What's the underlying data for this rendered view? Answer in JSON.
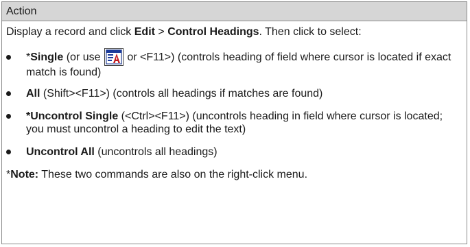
{
  "header": {
    "title": "Action"
  },
  "intro": {
    "text_before": "Display a record and click ",
    "menu_path_1": "Edit",
    "separator": " > ",
    "menu_path_2": "Control Headings",
    "text_after": ". Then click to select:"
  },
  "items": [
    {
      "prefix": "*",
      "bold": "Single",
      "text_a": " (or use ",
      "icon": "control-heading-toolbar-icon",
      "text_b": " or <F11>) (controls heading of field where cursor is located if exact match is found)"
    },
    {
      "prefix": "",
      "bold": "All",
      "text": " (Shift><F11>) (controls all headings if matches are found)"
    },
    {
      "prefix": "",
      "bold": "*Uncontrol Single",
      "text": " (<Ctrl><F11>) (uncontrols heading in field where cursor is located; you must uncontrol a heading  to edit the text)"
    },
    {
      "prefix": "",
      "bold": "Uncontrol All",
      "text": " (uncontrols all headings)"
    }
  ],
  "note": {
    "prefix": "*",
    "bold": "Note:",
    "text": " These two commands are also on the right-click menu."
  },
  "colors": {
    "header_bg": "#d6d6d6",
    "border": "#8a8a8a",
    "icon_blue": "#1a3a9a",
    "icon_red": "#c0181c"
  }
}
